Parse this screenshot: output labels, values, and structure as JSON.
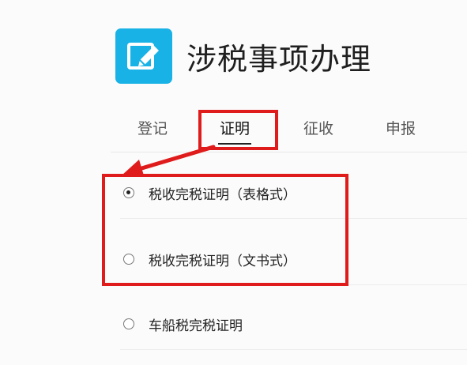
{
  "header": {
    "title": "涉税事项办理",
    "icon": "edit-icon",
    "icon_color": "#18b2e6"
  },
  "tabs": [
    {
      "label": "登记"
    },
    {
      "label": "证明",
      "active": true
    },
    {
      "label": "征收"
    },
    {
      "label": "申报"
    }
  ],
  "options": [
    {
      "label": "税收完税证明（表格式）",
      "selected": true
    },
    {
      "label": "税收完税证明（文书式）",
      "selected": false
    },
    {
      "label": "车船税完税证明",
      "selected": false
    }
  ],
  "annotation_color": "#e01b1b"
}
